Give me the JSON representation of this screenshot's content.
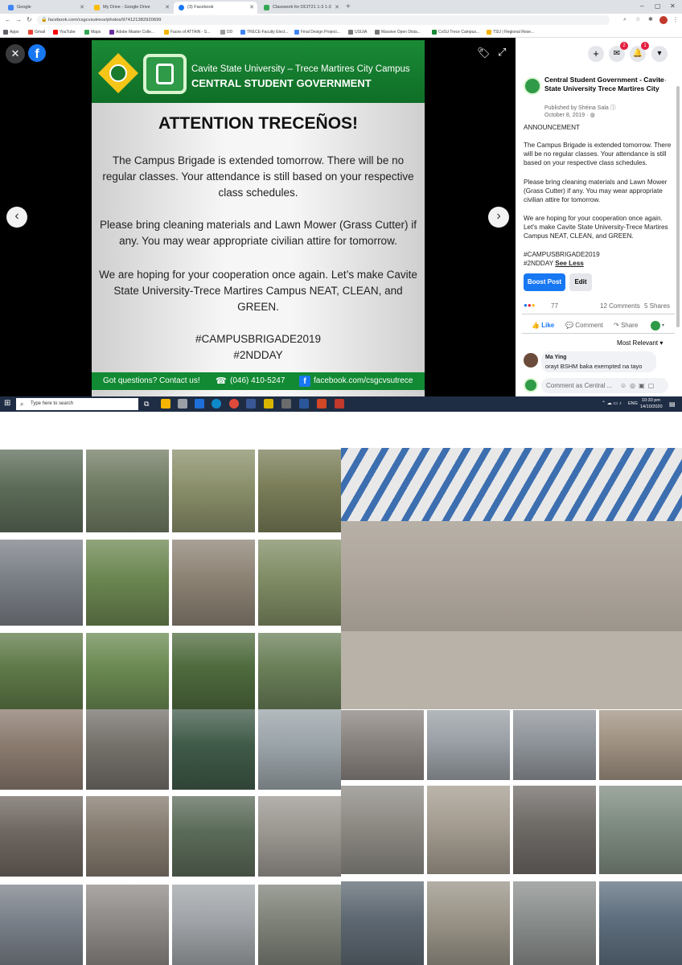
{
  "browser": {
    "tabs": [
      {
        "label": "Google",
        "icon_color": "#4285f4"
      },
      {
        "label": "My Drive - Google Drive",
        "icon_color": "#fbbc04"
      },
      {
        "label": "(3) Facebook",
        "icon_color": "#1877f2"
      },
      {
        "label": "Classwork for DCIT21 1-3 1-3",
        "icon_color": "#34a853"
      }
    ],
    "url": "facebook.com/csgcvsutrece/photos/974121382920699",
    "bookmarks": [
      {
        "label": "Apps",
        "color": "#5f6368"
      },
      {
        "label": "Gmail",
        "color": "#ea4335"
      },
      {
        "label": "YouTube",
        "color": "#ff0000"
      },
      {
        "label": "Maps",
        "color": "#34a853"
      },
      {
        "label": "Adobe Master Colle...",
        "color": "#6b2fa0"
      },
      {
        "label": "Faces of ATTAIN - S...",
        "color": "#f4b400"
      },
      {
        "label": "DD",
        "color": "#999999"
      },
      {
        "label": "TRECE-Faculty Elect...",
        "color": "#4285f4"
      },
      {
        "label": "Final Design Project...",
        "color": "#4285f4"
      },
      {
        "label": "USUIA",
        "color": "#777777"
      },
      {
        "label": "Massive Open Dista...",
        "color": "#777777"
      },
      {
        "label": "CvSU Trece Campus...",
        "color": "#1a8a36"
      },
      {
        "label": "TSU | Regional Rese...",
        "color": "#f4b400"
      }
    ]
  },
  "poster": {
    "university": "Cavite State University – Trece Martires City Campus",
    "org": "CENTRAL STUDENT GOVERNMENT",
    "heading": "ATTENTION TRECEÑOS!",
    "para1": "The Campus Brigade is extended tomorrow.  There will be no regular classes. Your attendance is still based on your respective class schedules.",
    "para2": "Please bring cleaning materials and Lawn Mower (Grass Cutter) if any. You may wear appropriate civilian attire for tomorrow.",
    "para3": "We are hoping for your cooperation once again. Let’s make Cavite State University-Trece Martires Campus NEAT, CLEAN, and GREEN.",
    "hashtag1": "#CAMPUSBRIGADE2019",
    "hashtag2": "#2NDDAY",
    "footer_contact": "Got questions? Contact us!",
    "footer_phone": "(046) 410-5247",
    "footer_fb": "facebook.com/csgcvsutrece"
  },
  "panel": {
    "notification_counts": {
      "messenger": "2",
      "notifications": "1"
    },
    "page_name": "Central Student Government - Cavite State University Trece Martires City",
    "published_by": "Published by Shéina Sala",
    "date": "October 8, 2019",
    "announcement": "ANNOUNCEMENT",
    "para1": "The Campus Brigade is extended tomorrow. There will be no regular classes. Your attendance is still based on your respective class schedules.",
    "para2": "Please bring cleaning materials and Lawn Mower (Grass Cutter) if any. You may wear appropriate civilian attire for tomorrow.",
    "para3": "We are hoping for your cooperation once again. Let's make Cavite State University-Trece Martires Campus NEAT, CLEAN, and GREEN.",
    "hashtag1": "#CAMPUSBRIGADE2019",
    "hashtag2": "#2NDDAY",
    "see_less": "See Less",
    "boost_label": "Boost Post",
    "edit_label": "Edit",
    "reactions_count": "77",
    "comments_count": "12 Comments",
    "shares_count": "5 Shares",
    "like_label": "Like",
    "comment_label": "Comment",
    "share_label": "Share",
    "sort_label": "Most Relevant",
    "commenter_name": "Ma Ying",
    "comment_text": "orayt BSHM baka exempted na tayo",
    "comment_placeholder": "Comment as Central ..."
  },
  "taskbar": {
    "search_placeholder": "Type here to search",
    "lang": "ENG",
    "time": "10:30 pm",
    "date": "14/10/2020"
  },
  "photos": [
    {
      "bg": "#5c6b58"
    },
    {
      "bg": "#6f7b62"
    },
    {
      "bg": "#8a8f6a"
    },
    {
      "bg": "#7a7d58"
    },
    {
      "bg": "#7a7f86"
    },
    {
      "bg": "#6b8650"
    },
    {
      "bg": "#8c8274"
    },
    {
      "bg": "#7f8c64"
    },
    {
      "bg": "#5f7a48"
    },
    {
      "bg": "#6b8a52"
    },
    {
      "bg": "#4f6b3e"
    },
    {
      "bg": "#6a7f58"
    },
    {
      "bg": "#8a7a6e"
    },
    {
      "bg": "#74706a"
    },
    {
      "bg": "#3f5a48"
    },
    {
      "bg": "#9aa3a8"
    },
    {
      "bg": "#6e6660"
    },
    {
      "bg": "#847a6e"
    },
    {
      "bg": "#5a6a58"
    },
    {
      "bg": "#9a9690"
    },
    {
      "bg": "#7a8089"
    },
    {
      "bg": "#8e8a88"
    },
    {
      "bg": "#a0a4a8"
    },
    {
      "bg": "#7e8278"
    },
    {
      "bg": "#b0a89e"
    },
    {
      "bg": "#8a8480"
    },
    {
      "bg": "#9aa0a6"
    },
    {
      "bg": "#8f949a"
    },
    {
      "bg": "#a09282"
    },
    {
      "bg": "#8d8a84"
    },
    {
      "bg": "#a49c90"
    },
    {
      "bg": "#6e6a66"
    },
    {
      "bg": "#7e8b80"
    },
    {
      "bg": "#5e6872"
    },
    {
      "bg": "#9a9488"
    },
    {
      "bg": "#8a8e8c"
    },
    {
      "bg": "#5e6e7e"
    }
  ]
}
